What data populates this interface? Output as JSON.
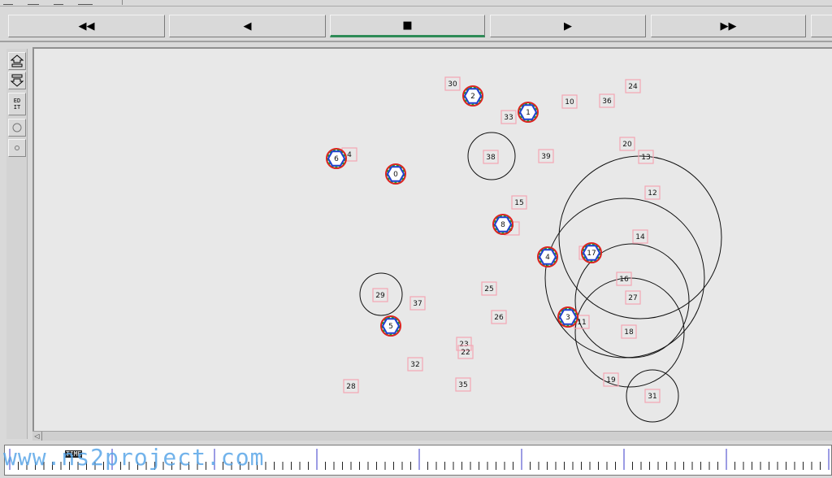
{
  "toolbar": {
    "buttons": [
      {
        "name": "rewind-button",
        "glyph": "◀◀"
      },
      {
        "name": "step-back-button",
        "glyph": "◀"
      },
      {
        "name": "stop-button",
        "glyph": "■"
      },
      {
        "name": "play-button",
        "glyph": "▶"
      },
      {
        "name": "fast-forward-button",
        "glyph": "▶▶"
      }
    ],
    "active_button": "stop-button"
  },
  "tools": {
    "edit_label_top": "ED",
    "edit_label_bottom": "IT"
  },
  "timeline": {
    "time_label": "TIME"
  },
  "watermark": "www.ns2project.com",
  "colors": {
    "canvas_bg": "#e8e8e8",
    "node_ring_outer": "#e02020",
    "node_ring_mid": "#20a020",
    "node_ring_inner": "#2040d0",
    "plain_box": "#f4a6b4",
    "range_circle": "#111111"
  },
  "network": {
    "hex_nodes": [
      {
        "id": "0"
      },
      {
        "id": "1"
      },
      {
        "id": "2"
      },
      {
        "id": "3"
      },
      {
        "id": "4"
      },
      {
        "id": "5"
      },
      {
        "id": "6"
      },
      {
        "id": "8"
      },
      {
        "id": "17"
      }
    ],
    "plain_nodes": [
      {
        "id": "30"
      },
      {
        "id": "33"
      },
      {
        "id": "10"
      },
      {
        "id": "36"
      },
      {
        "id": "24"
      },
      {
        "id": "4"
      },
      {
        "id": "38"
      },
      {
        "id": "39"
      },
      {
        "id": "20"
      },
      {
        "id": "13"
      },
      {
        "id": "15"
      },
      {
        "id": "12"
      },
      {
        "id": "7"
      },
      {
        "id": "14"
      },
      {
        "id": "9"
      },
      {
        "id": "16"
      },
      {
        "id": "29"
      },
      {
        "id": "37"
      },
      {
        "id": "25"
      },
      {
        "id": "27"
      },
      {
        "id": "26"
      },
      {
        "id": "11"
      },
      {
        "id": "18"
      },
      {
        "id": "23"
      },
      {
        "id": "22"
      },
      {
        "id": "32"
      },
      {
        "id": "28"
      },
      {
        "id": "35"
      },
      {
        "id": "19"
      },
      {
        "id": "31"
      }
    ]
  }
}
